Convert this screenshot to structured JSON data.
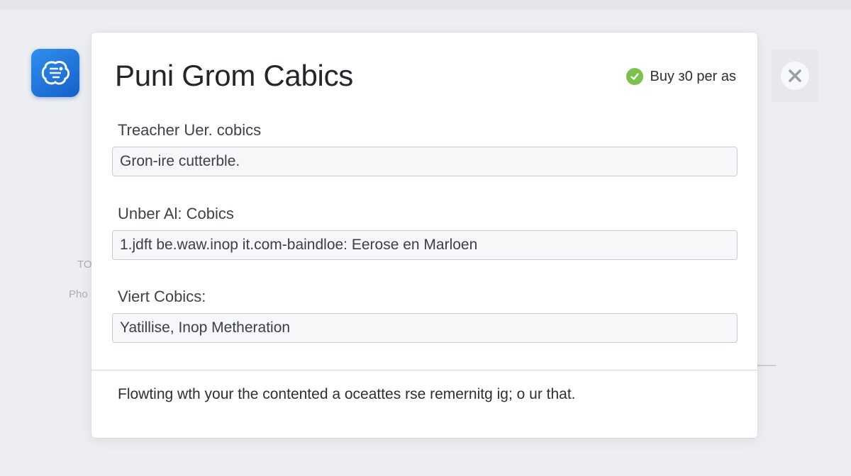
{
  "app": {
    "logo_icon": "brain-circuit-icon",
    "accent": "#1f74dc"
  },
  "background": {
    "side_labels": [
      "TO",
      "Pho"
    ]
  },
  "modal": {
    "title": "Puni Grom Cabics",
    "status": {
      "icon": "check-circle-icon",
      "color": "#7cc24a",
      "text": "Buy з0 per as"
    },
    "fields": [
      {
        "label": "Treacher Uer. cobics",
        "value": "Gron-ire cutterble."
      },
      {
        "label": "Unber Al: Cobics",
        "value": "1.jdft be.waw.inop it.com-baindloe: Eerose en Marloen"
      },
      {
        "label": "Viert Cobics:",
        "value": "Yatillise, Inop Metheration"
      }
    ],
    "footer_text": "Flowting wth your the contented a oceattes rse remernitg ig; o ur that."
  },
  "close": {
    "icon": "close-icon"
  }
}
